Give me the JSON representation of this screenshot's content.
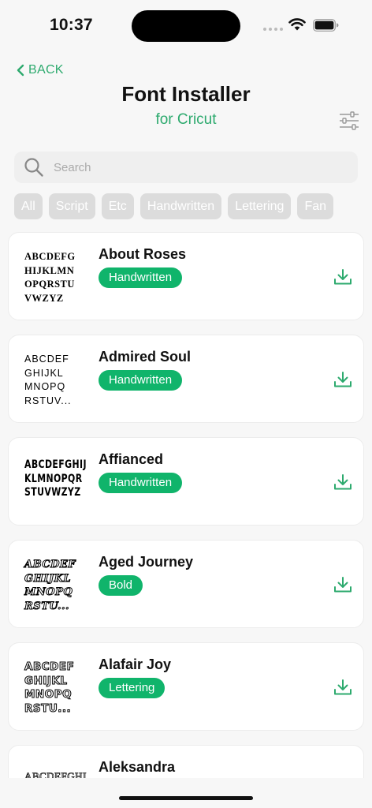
{
  "status_bar": {
    "time": "10:37"
  },
  "nav": {
    "back_label": "BACK"
  },
  "header": {
    "title": "Font Installer",
    "subtitle": "for Cricut"
  },
  "search": {
    "placeholder": "Search",
    "value": ""
  },
  "categories": [
    "All",
    "Script",
    "Etc",
    "Handwritten",
    "Lettering",
    "Fan"
  ],
  "fonts": [
    {
      "name": "About Roses",
      "tag": "Handwritten",
      "preview": "ABCDEFG\nHIJKLMN\nOPQRSTU\nVWZYZ",
      "style": "serif"
    },
    {
      "name": "Admired Soul",
      "tag": "Handwritten",
      "preview": "ABCDEF\nGHIJKL\nMNOPQ\nRSTUV...",
      "style": "sans"
    },
    {
      "name": "Affianced",
      "tag": "Handwritten",
      "preview": "ABCDEFGHIJ\nKLMNOPQR\nSTUVWZYZ",
      "style": "condensed"
    },
    {
      "name": "Aged Journey",
      "tag": "Bold",
      "preview": "ABCDEF\nGHIJKL\nMNOPQ\nRSTU...",
      "style": "gothic"
    },
    {
      "name": "Alafair Joy",
      "tag": "Lettering",
      "preview": "ABCDEF\nGHIJKL\nMNOPQ\nRSTU...",
      "style": "outline"
    },
    {
      "name": "Aleksandra",
      "tag": "",
      "preview": "ABCDEFGHI\nJKLMNOP",
      "style": "engraved"
    }
  ],
  "colors": {
    "accent": "#2daa6e",
    "tag_bg": "#10b46b",
    "chip_bg": "#dcdcdc"
  }
}
